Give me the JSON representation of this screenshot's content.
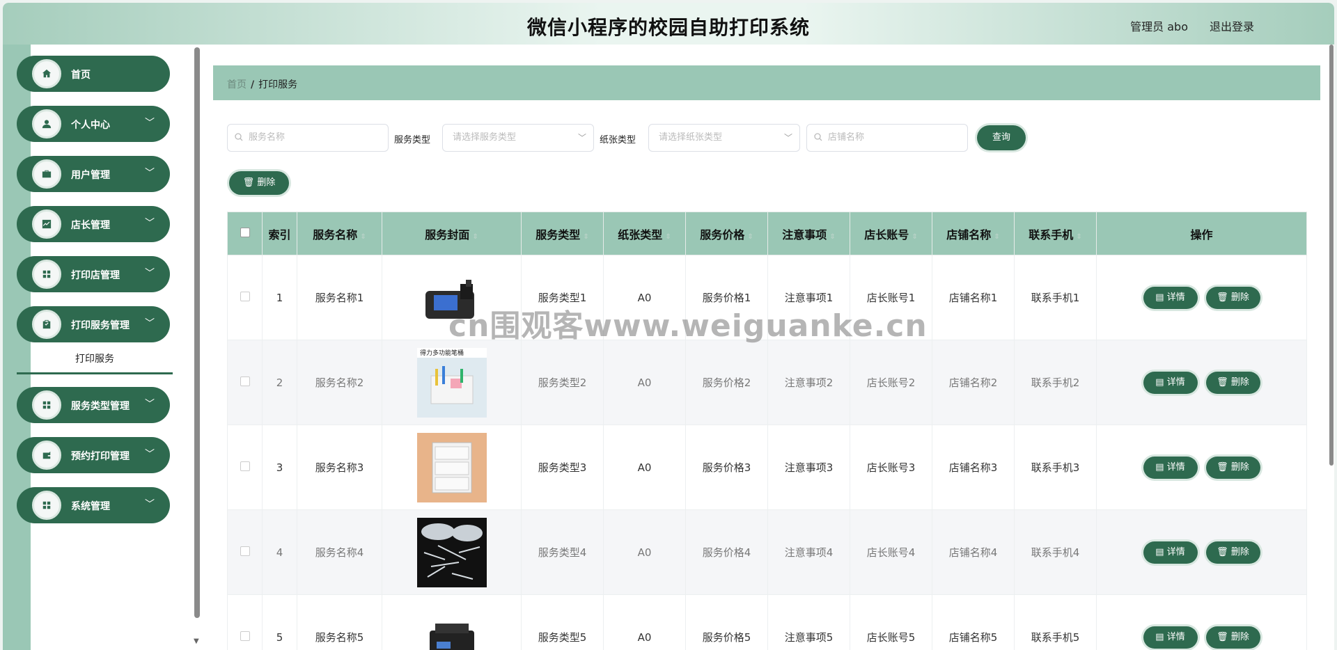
{
  "header": {
    "title": "微信小程序的校园自助打印系统",
    "user": "管理员 abo",
    "logout": "退出登录"
  },
  "sidebar": {
    "items": [
      {
        "label": "首页",
        "icon": "home-icon",
        "chevron": ""
      },
      {
        "label": "个人中心",
        "icon": "user-icon",
        "chevron": "﹀"
      },
      {
        "label": "用户管理",
        "icon": "briefcase-icon",
        "chevron": "﹀"
      },
      {
        "label": "店长管理",
        "icon": "chart-icon",
        "chevron": "﹀"
      },
      {
        "label": "打印店管理",
        "icon": "grid-icon",
        "chevron": "﹀"
      },
      {
        "label": "打印服务管理",
        "icon": "clipboard-icon",
        "chevron": "﹀"
      },
      {
        "label": "服务类型管理",
        "icon": "grid-icon",
        "chevron": "﹀"
      },
      {
        "label": "预约打印管理",
        "icon": "wallet-icon",
        "chevron": "﹀"
      },
      {
        "label": "系统管理",
        "icon": "grid-icon",
        "chevron": "﹀"
      }
    ],
    "sub_item": "打印服务"
  },
  "breadcrumb": {
    "home": "首页",
    "sep": "/",
    "current": "打印服务"
  },
  "search": {
    "service_name_placeholder": "服务名称",
    "service_type_label": "服务类型",
    "service_type_placeholder": "请选择服务类型",
    "paper_type_label": "纸张类型",
    "paper_type_placeholder": "请选择纸张类型",
    "shop_name_placeholder": "店铺名称",
    "query_label": "查询"
  },
  "toolbar": {
    "delete_label": "删除"
  },
  "table": {
    "headers": [
      "索引",
      "服务名称",
      "服务封面",
      "服务类型",
      "纸张类型",
      "服务价格",
      "注意事项",
      "店长账号",
      "店铺名称",
      "联系手机",
      "操作"
    ],
    "rows": [
      {
        "index": "1",
        "name": "服务名称1",
        "type": "服务类型1",
        "paper": "A0",
        "price": "服务价格1",
        "notes": "注意事项1",
        "account": "店长账号1",
        "shop": "店铺名称1",
        "phone": "联系手机1"
      },
      {
        "index": "2",
        "name": "服务名称2",
        "type": "服务类型2",
        "paper": "A0",
        "price": "服务价格2",
        "notes": "注意事项2",
        "account": "店长账号2",
        "shop": "店铺名称2",
        "phone": "联系手机2",
        "image_caption": "得力多功能笔桶"
      },
      {
        "index": "3",
        "name": "服务名称3",
        "type": "服务类型3",
        "paper": "A0",
        "price": "服务价格3",
        "notes": "注意事项3",
        "account": "店长账号3",
        "shop": "店铺名称3",
        "phone": "联系手机3"
      },
      {
        "index": "4",
        "name": "服务名称4",
        "type": "服务类型4",
        "paper": "A0",
        "price": "服务价格4",
        "notes": "注意事项4",
        "account": "店长账号4",
        "shop": "店铺名称4",
        "phone": "联系手机4"
      },
      {
        "index": "5",
        "name": "服务名称5",
        "type": "服务类型5",
        "paper": "A0",
        "price": "服务价格5",
        "notes": "注意事项5",
        "account": "店长账号5",
        "shop": "店铺名称5",
        "phone": "联系手机5"
      }
    ],
    "detail_label": "详情",
    "delete_label": "删除"
  },
  "watermark": "cn围观客www.weiguanke.cn",
  "colors": {
    "primary": "#2e6a4f",
    "accent": "#9ac7b5"
  }
}
